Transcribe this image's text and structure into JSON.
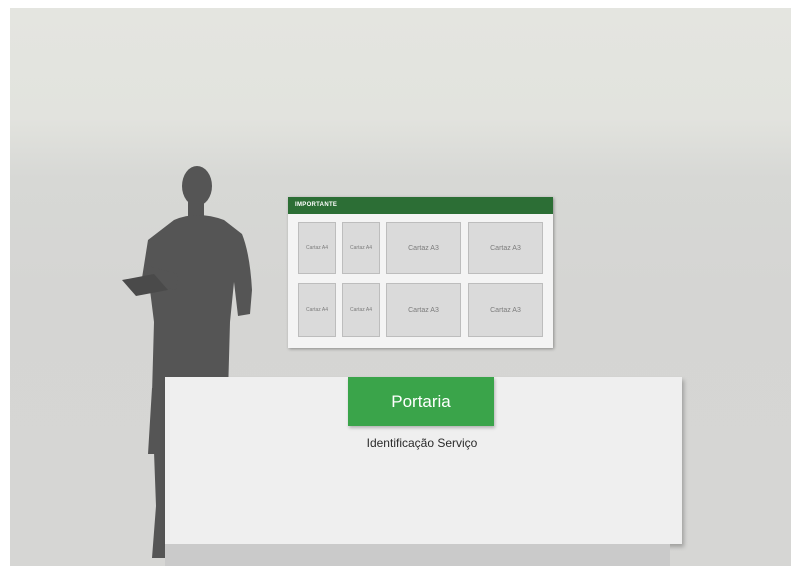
{
  "scene": {
    "board": {
      "header": "IMPORTANTE",
      "posters": [
        {
          "label": "Cartaz A4",
          "size": "A4"
        },
        {
          "label": "Cartaz A4",
          "size": "A4"
        },
        {
          "label": "Cartaz A3",
          "size": "A3"
        },
        {
          "label": "Cartaz A3",
          "size": "A3"
        },
        {
          "label": "Cartaz A4",
          "size": "A4"
        },
        {
          "label": "Cartaz A4",
          "size": "A4"
        },
        {
          "label": "Cartaz A3",
          "size": "A3"
        },
        {
          "label": "Cartaz A3",
          "size": "A3"
        }
      ]
    },
    "sign": "Portaria",
    "subtitle": "Identificação Serviço"
  },
  "colors": {
    "header_green": "#2c6e35",
    "sign_green": "#3aa44a",
    "silhouette": "#555555"
  }
}
